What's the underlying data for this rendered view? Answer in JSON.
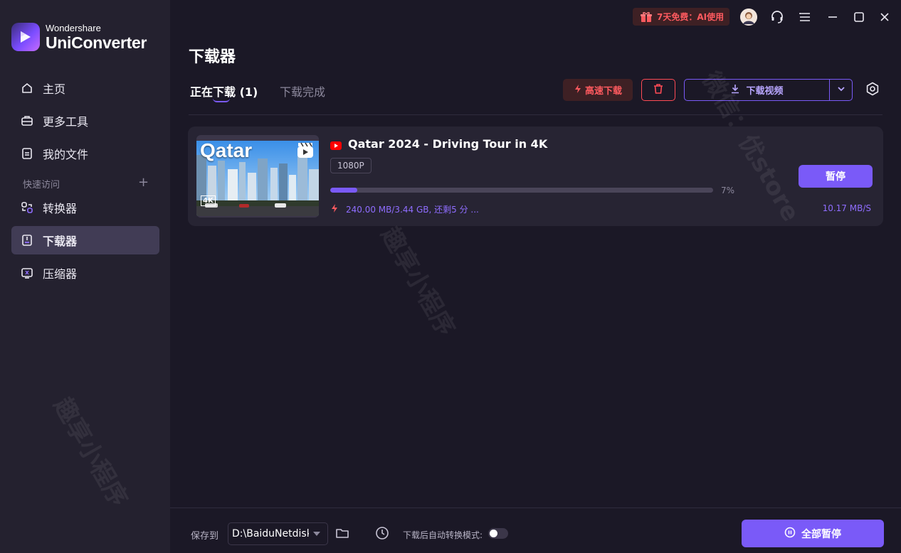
{
  "app": {
    "brand_sub": "Wondershare",
    "brand_main": "UniConverter"
  },
  "titlebar": {
    "promo": "7天免费：AI使用",
    "icons": [
      "avatar",
      "headset-icon",
      "menu-icon",
      "minimize-icon",
      "maximize-icon",
      "close-icon"
    ]
  },
  "sidebar": {
    "items": [
      {
        "label": "主页",
        "icon": "home-icon"
      },
      {
        "label": "更多工具",
        "icon": "toolbox-icon"
      },
      {
        "label": "我的文件",
        "icon": "file-icon"
      }
    ],
    "section": "快速访问",
    "quick": [
      {
        "label": "转换器",
        "icon": "converter-icon"
      },
      {
        "label": "下载器",
        "icon": "downloader-icon",
        "active": true
      },
      {
        "label": "压缩器",
        "icon": "compressor-icon"
      }
    ]
  },
  "main": {
    "title": "下载器",
    "tab_active": "正在下载 (1)",
    "tab_inactive": "下载完成",
    "fast_download": "高速下载",
    "download_video": "下载视频"
  },
  "task": {
    "thumb_text": "Qatar",
    "thumb_badge": "4K",
    "title": "Qatar 2024 - Driving Tour in 4K",
    "resolution": "1080P",
    "progress_percent": 7,
    "progress_label": "7%",
    "stats": "240.00 MB/3.44 GB, 还剩5 分 ...",
    "speed": "10.17 MB/S",
    "pause": "暂停"
  },
  "footer": {
    "save_to": "保存到",
    "path": "D:\\BaiduNetdisk",
    "auto_convert": "下载后自动转换模式:",
    "auto_convert_on": false,
    "pause_all": "全部暂停"
  },
  "watermarks": {
    "w1": "微信：优store",
    "w2": "趣享小程序",
    "w3": "趣享小程序"
  },
  "colors": {
    "accent": "#7a5af8",
    "danger": "#ff4b55",
    "background": "#1b1826",
    "sidebar": "#24212f"
  }
}
